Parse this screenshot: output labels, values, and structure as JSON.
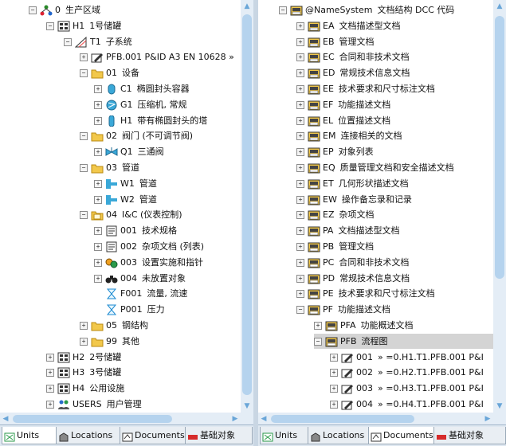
{
  "left_tree": {
    "rows": [
      {
        "indent": 36,
        "exp": "⊟",
        "icon": "structure",
        "code": "0",
        "label": "生产区域"
      },
      {
        "indent": 58,
        "exp": "⊟",
        "icon": "grid",
        "code": "H1",
        "label": "1号储罐"
      },
      {
        "indent": 80,
        "exp": "⊟",
        "icon": "triangle",
        "code": "T1",
        "label": "子系统"
      },
      {
        "indent": 100,
        "exp": "⊞",
        "icon": "drawing",
        "code": "",
        "label": "PFB.001  P&ID A3 EN 10628  »"
      },
      {
        "indent": 100,
        "exp": "⊟",
        "icon": "folder",
        "code": "01",
        "label": "设备"
      },
      {
        "indent": 118,
        "exp": "⊞",
        "icon": "vessel",
        "code": "C1",
        "label": "椭圆封头容器"
      },
      {
        "indent": 118,
        "exp": "⊞",
        "icon": "compressor",
        "code": "G1",
        "label": "压缩机, 常规"
      },
      {
        "indent": 118,
        "exp": "⊞",
        "icon": "tower",
        "code": "H1",
        "label": "带有椭圆封头的塔"
      },
      {
        "indent": 100,
        "exp": "⊟",
        "icon": "folder",
        "code": "02",
        "label": "阀门 (不可调节阀)"
      },
      {
        "indent": 118,
        "exp": "⊞",
        "icon": "valve",
        "code": "Q1",
        "label": "三通阀"
      },
      {
        "indent": 100,
        "exp": "⊟",
        "icon": "folder",
        "code": "03",
        "label": "管道"
      },
      {
        "indent": 118,
        "exp": "⊞",
        "icon": "pipe",
        "code": "W1",
        "label": "管道"
      },
      {
        "indent": 118,
        "exp": "⊞",
        "icon": "pipe",
        "code": "W2",
        "label": "管道"
      },
      {
        "indent": 100,
        "exp": "⊟",
        "icon": "folder-open",
        "code": "04",
        "label": "I&C (仪表控制)"
      },
      {
        "indent": 118,
        "exp": "⊞",
        "icon": "doc",
        "code": "001",
        "label": "技术规格"
      },
      {
        "indent": 118,
        "exp": "⊞",
        "icon": "doc",
        "code": "002",
        "label": "杂项文档 (列表)"
      },
      {
        "indent": 118,
        "exp": "⊞",
        "icon": "gears",
        "code": "003",
        "label": "设置实施和指针"
      },
      {
        "indent": 118,
        "exp": "⊞",
        "icon": "binoculars",
        "code": "004",
        "label": "未放置对象"
      },
      {
        "indent": 118,
        "exp": "none",
        "icon": "hourglass",
        "code": "F001",
        "label": "流量, 流速"
      },
      {
        "indent": 118,
        "exp": "none",
        "icon": "hourglass",
        "code": "P001",
        "label": "压力"
      },
      {
        "indent": 100,
        "exp": "⊞",
        "icon": "folder",
        "code": "05",
        "label": "钢结构"
      },
      {
        "indent": 100,
        "exp": "⊞",
        "icon": "folder",
        "code": "99",
        "label": "其他"
      },
      {
        "indent": 58,
        "exp": "⊞",
        "icon": "grid",
        "code": "H2",
        "label": "2号储罐"
      },
      {
        "indent": 58,
        "exp": "⊞",
        "icon": "grid",
        "code": "H3",
        "label": "3号储罐"
      },
      {
        "indent": 58,
        "exp": "⊞",
        "icon": "grid",
        "code": "H4",
        "label": "公用设施"
      },
      {
        "indent": 58,
        "exp": "⊞",
        "icon": "users",
        "code": "USERS",
        "label": "用户管理"
      }
    ]
  },
  "right_tree": {
    "rows": [
      {
        "indent": 350,
        "exp": "⊟",
        "icon": "cabinet",
        "code": "@NameSystem",
        "label": "文档结构 DCC 代码"
      },
      {
        "indent": 372,
        "exp": "⊞",
        "icon": "cabinet",
        "code": "EA",
        "label": "文档描述型文档"
      },
      {
        "indent": 372,
        "exp": "⊞",
        "icon": "cabinet",
        "code": "EB",
        "label": "管理文档"
      },
      {
        "indent": 372,
        "exp": "⊞",
        "icon": "cabinet",
        "code": "EC",
        "label": "合同和非技术文档"
      },
      {
        "indent": 372,
        "exp": "⊞",
        "icon": "cabinet",
        "code": "ED",
        "label": "常规技术信息文档"
      },
      {
        "indent": 372,
        "exp": "⊞",
        "icon": "cabinet",
        "code": "EE",
        "label": "技术要求和尺寸标注文档"
      },
      {
        "indent": 372,
        "exp": "⊞",
        "icon": "cabinet",
        "code": "EF",
        "label": "功能描述文档"
      },
      {
        "indent": 372,
        "exp": "⊞",
        "icon": "cabinet",
        "code": "EL",
        "label": "位置描述文档"
      },
      {
        "indent": 372,
        "exp": "⊞",
        "icon": "cabinet",
        "code": "EM",
        "label": "连接相关的文档"
      },
      {
        "indent": 372,
        "exp": "⊞",
        "icon": "cabinet",
        "code": "EP",
        "label": "对象列表"
      },
      {
        "indent": 372,
        "exp": "⊞",
        "icon": "cabinet",
        "code": "EQ",
        "label": "质量管理文档和安全描述文档"
      },
      {
        "indent": 372,
        "exp": "⊞",
        "icon": "cabinet",
        "code": "ET",
        "label": "几何形状描述文档"
      },
      {
        "indent": 372,
        "exp": "⊞",
        "icon": "cabinet",
        "code": "EW",
        "label": "操作备忘录和记录"
      },
      {
        "indent": 372,
        "exp": "⊞",
        "icon": "cabinet",
        "code": "EZ",
        "label": "杂项文档"
      },
      {
        "indent": 372,
        "exp": "⊞",
        "icon": "cabinet",
        "code": "PA",
        "label": "文档描述型文档"
      },
      {
        "indent": 372,
        "exp": "⊞",
        "icon": "cabinet",
        "code": "PB",
        "label": "管理文档"
      },
      {
        "indent": 372,
        "exp": "⊞",
        "icon": "cabinet",
        "code": "PC",
        "label": "合同和非技术文档"
      },
      {
        "indent": 372,
        "exp": "⊞",
        "icon": "cabinet",
        "code": "PD",
        "label": "常规技术信息文档"
      },
      {
        "indent": 372,
        "exp": "⊞",
        "icon": "cabinet",
        "code": "PE",
        "label": "技术要求和尺寸标注文档"
      },
      {
        "indent": 372,
        "exp": "⊟",
        "icon": "cabinet",
        "code": "PF",
        "label": "功能描述文档"
      },
      {
        "indent": 394,
        "exp": "⊞",
        "icon": "cabinet",
        "code": "PFA",
        "label": "功能概述文档"
      },
      {
        "indent": 394,
        "exp": "⊟",
        "icon": "cabinet",
        "code": "PFB",
        "label": "流程图",
        "selected": true
      },
      {
        "indent": 414,
        "exp": "⊞",
        "icon": "drawing",
        "code": "001",
        "label": "»  =0.H1.T1.PFB.001   P&I"
      },
      {
        "indent": 414,
        "exp": "⊞",
        "icon": "drawing",
        "code": "002",
        "label": "»  =0.H2.T1.PFB.001   P&I"
      },
      {
        "indent": 414,
        "exp": "⊞",
        "icon": "drawing",
        "code": "003",
        "label": "»  =0.H3.T1.PFB.001   P&I"
      },
      {
        "indent": 414,
        "exp": "⊞",
        "icon": "drawing",
        "code": "004",
        "label": "»  =0.H4.T1.PFB.001   P&I"
      }
    ]
  },
  "left_tabs": [
    {
      "label": "Units",
      "icon": "units-icon"
    },
    {
      "label": "Locations",
      "icon": "locations-icon"
    },
    {
      "label": "Documents",
      "icon": "documents-icon"
    },
    {
      "label": "基础对象",
      "icon": "base-objects-icon"
    }
  ],
  "right_tabs": [
    {
      "label": "Units",
      "icon": "units-icon"
    },
    {
      "label": "Locations",
      "icon": "locations-icon"
    },
    {
      "label": "Documents",
      "icon": "documents-icon"
    },
    {
      "label": "基础对象",
      "icon": "base-objects-icon"
    }
  ],
  "colors": {
    "accent": "#6aa6d8",
    "folder": "#f2c84b",
    "selection": "#d4d4d4"
  }
}
